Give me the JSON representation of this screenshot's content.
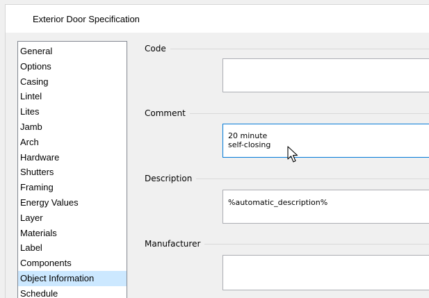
{
  "dialog": {
    "title": "Exterior Door Specification"
  },
  "categories": {
    "items": [
      "General",
      "Options",
      "Casing",
      "Lintel",
      "Lites",
      "Jamb",
      "Arch",
      "Hardware",
      "Shutters",
      "Framing",
      "Energy Values",
      "Layer",
      "Materials",
      "Label",
      "Components",
      "Object Information",
      "Schedule"
    ],
    "selected": "Object Information"
  },
  "fields": {
    "code": {
      "label": "Code",
      "value": ""
    },
    "comment": {
      "label": "Comment",
      "value": "20 minute\nself-closing"
    },
    "description": {
      "label": "Description",
      "value": "%automatic_description%"
    },
    "manufacturer": {
      "label": "Manufacturer",
      "value": ""
    }
  },
  "colors": {
    "selection": "#cce8ff",
    "focus_border": "#0078d7",
    "dialog_bg": "#f0f0f0"
  }
}
